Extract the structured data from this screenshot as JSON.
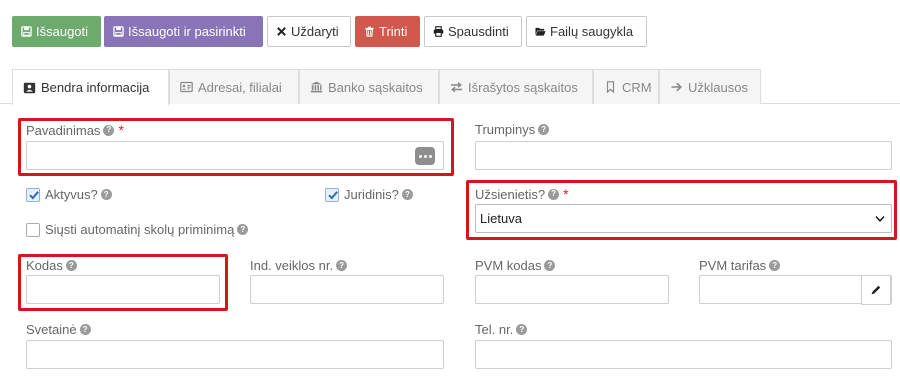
{
  "toolbar": {
    "save": "Išsaugoti",
    "save_select": "Išsaugoti ir pasirinkti",
    "close": "Uždaryti",
    "delete": "Trinti",
    "print": "Spausdinti",
    "files": "Failų saugykla"
  },
  "tabs": [
    {
      "label": "Bendra informacija",
      "icon": "id-card-icon"
    },
    {
      "label": "Adresai, filialai",
      "icon": "address-card-icon"
    },
    {
      "label": "Banko sąskaitos",
      "icon": "bank-icon"
    },
    {
      "label": "Išrašytos sąskaitos",
      "icon": "exchange-icon"
    },
    {
      "label": "CRM",
      "icon": "bookmark-icon"
    },
    {
      "label": "Užklausos",
      "icon": "arrow-right-icon"
    }
  ],
  "form": {
    "pavadinimas": {
      "label": "Pavadinimas",
      "value": ""
    },
    "trumpinys": {
      "label": "Trumpinys",
      "value": ""
    },
    "aktyvus": {
      "label": "Aktyvus?",
      "checked": true
    },
    "juridinis": {
      "label": "Juridinis?",
      "checked": true
    },
    "siusti": {
      "label": "Siųsti automatinį skolų priminimą",
      "checked": false
    },
    "uzsienietis": {
      "label": "Užsienietis?",
      "value": "Lietuva"
    },
    "kodas": {
      "label": "Kodas",
      "value": ""
    },
    "ind_veiklos": {
      "label": "Ind. veiklos nr.",
      "value": ""
    },
    "pvm_kodas": {
      "label": "PVM kodas",
      "value": ""
    },
    "pvm_tarifas": {
      "label": "PVM tarifas",
      "value": ""
    },
    "svetaine": {
      "label": "Svetainė",
      "value": ""
    },
    "tel": {
      "label": "Tel. nr.",
      "value": ""
    }
  },
  "colors": {
    "save": "#6cab6d",
    "save_select": "#8a74b8",
    "delete": "#d2584e",
    "highlight": "#d6161b",
    "required": "#d2232a"
  }
}
